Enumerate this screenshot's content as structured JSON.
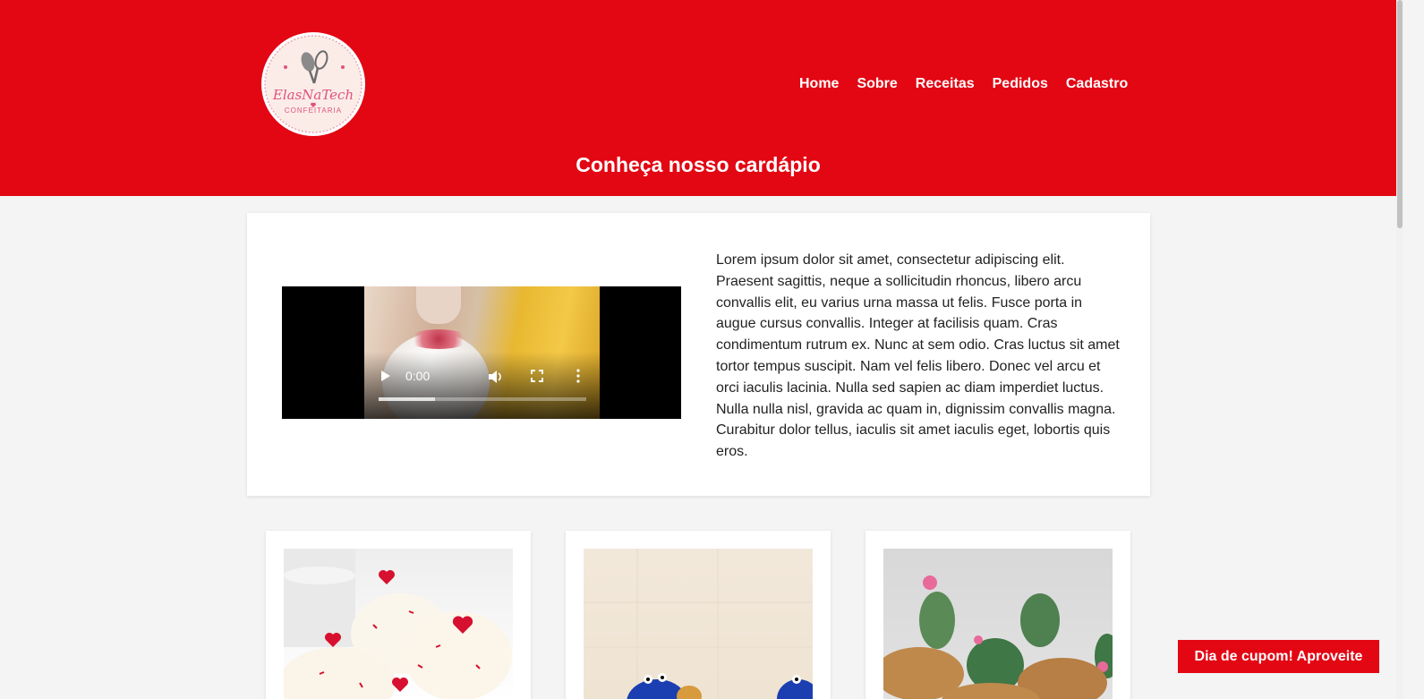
{
  "brand": {
    "logo_main": "ElasNaTech",
    "logo_sub": "CONFEITARIA"
  },
  "nav": {
    "items": [
      {
        "label": "Home"
      },
      {
        "label": "Sobre"
      },
      {
        "label": "Receitas"
      },
      {
        "label": "Pedidos"
      },
      {
        "label": "Cadastro"
      }
    ]
  },
  "header": {
    "title": "Conheça nosso cardápio"
  },
  "intro": {
    "video": {
      "time": "0:00",
      "progress": 0.27
    },
    "text": "Lorem ipsum dolor sit amet, consectetur adipiscing elit. Praesent sagittis, neque a sollicitudin rhoncus, libero arcu convallis elit, eu varius urna massa ut felis. Fusce porta in augue cursus convallis. Integer at facilisis quam. Cras condimentum rutrum ex. Nunc at sem odio. Cras luctus sit amet tortor tempus suscipit. Nam vel felis libero. Donec vel arcu et orci iaculis lacinia. Nulla sed sapien ac diam imperdiet luctus. Nulla nulla nisl, gravida ac quam in, dignissim convallis magna. Curabitur dolor tellus, iaculis sit amet iaculis eget, lobortis quis eros."
  },
  "products": [
    {
      "image": "red-velvet-cupcakes-image"
    },
    {
      "image": "blue-monster-cupcakes-image"
    },
    {
      "image": "cactus-cupcakes-image"
    }
  ],
  "coupon": {
    "label": "Dia de cupom! Aproveite"
  },
  "colors": {
    "primary_red": "#e30613",
    "background": "#f4f4f4",
    "card": "#ffffff",
    "logo_pink": "#e0527a"
  }
}
